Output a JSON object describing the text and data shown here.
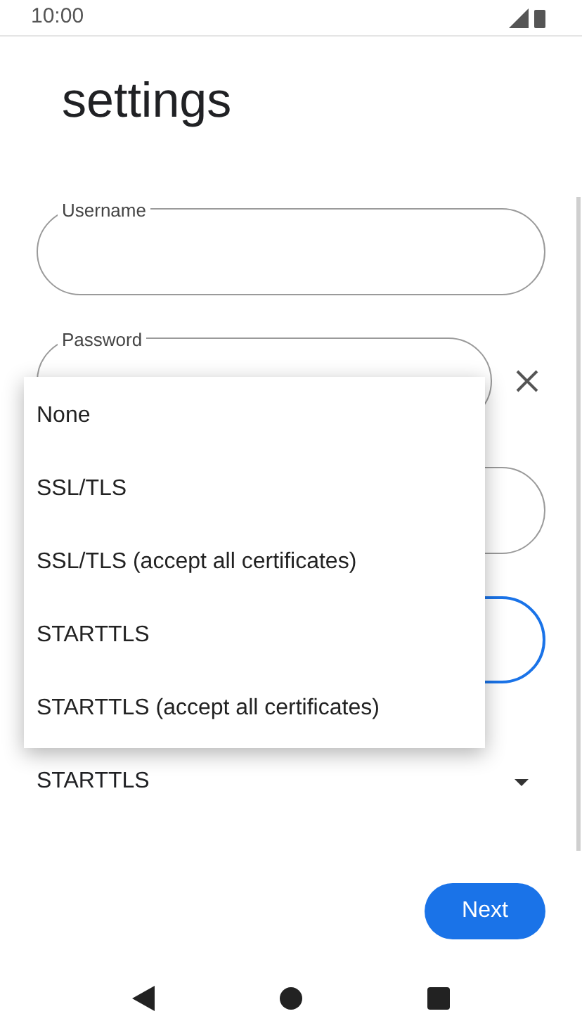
{
  "status_bar": {
    "time": "10:00"
  },
  "title": "settings",
  "username_field": {
    "label": "Username"
  },
  "password_field": {
    "label": "Password"
  },
  "security_menu": {
    "items": [
      {
        "label": "None"
      },
      {
        "label": "SSL/TLS"
      },
      {
        "label": "SSL/TLS (accept all certificates)"
      },
      {
        "label": "STARTTLS"
      },
      {
        "label": "STARTTLS (accept all certificates)"
      }
    ]
  },
  "security_select": {
    "value": "STARTTLS"
  },
  "next_button": "Next"
}
